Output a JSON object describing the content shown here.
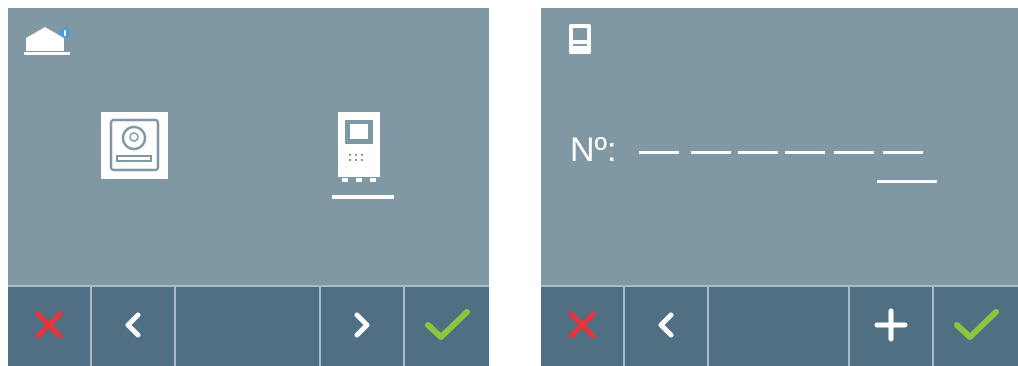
{
  "left_screen": {
    "home_icon": "home-notification-icon",
    "options": [
      {
        "name": "door-panel-icon",
        "selected": false
      },
      {
        "name": "monitor-icon",
        "selected": true
      }
    ],
    "buttons": [
      "cancel-icon",
      "previous-icon",
      "next-icon",
      "confirm-icon"
    ]
  },
  "right_screen": {
    "monitor_icon": "monitor-icon",
    "number_label": "Nº:",
    "number_digits": 6,
    "selected_digit": 6,
    "buttons": [
      "cancel-icon",
      "previous-icon",
      "increment-icon",
      "confirm-icon"
    ]
  },
  "colors": {
    "screen_bg": "#7f98a4",
    "bar_bg": "#506f83",
    "cancel": "#e8343a",
    "confirm": "#8cc63f"
  }
}
